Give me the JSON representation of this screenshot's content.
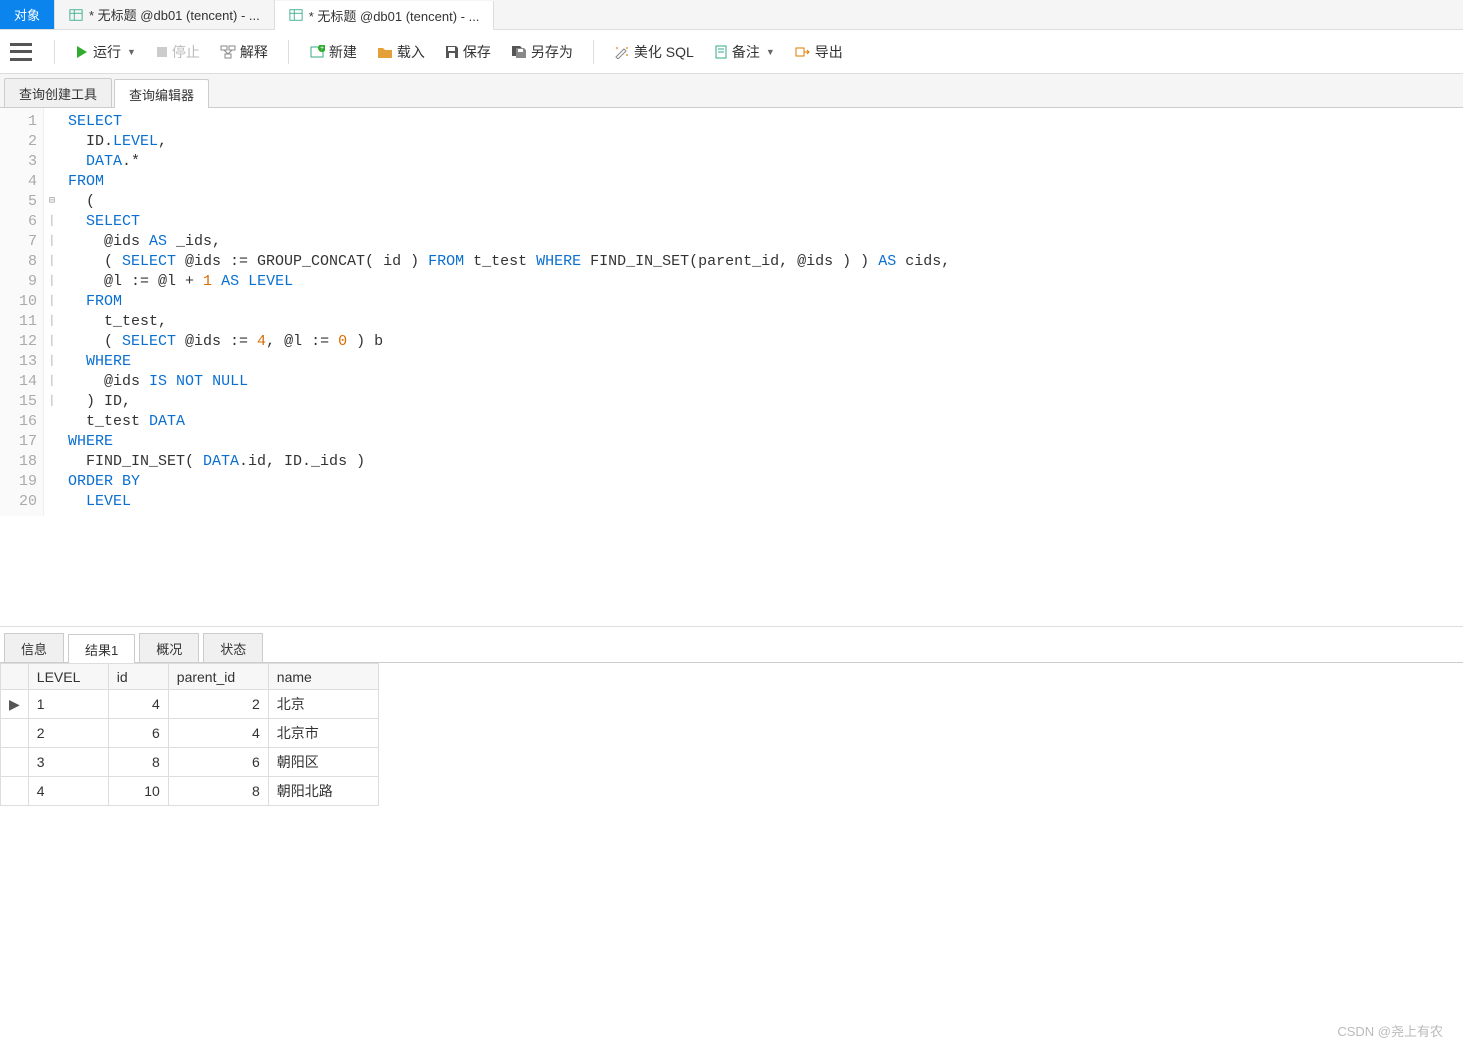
{
  "top_tabs": [
    {
      "label": "对象",
      "kind": "object",
      "active": "blue"
    },
    {
      "label": "* 无标题 @db01 (tencent) - ...",
      "kind": "query",
      "active": ""
    },
    {
      "label": "* 无标题 @db01 (tencent) - ...",
      "kind": "query",
      "active": "white"
    }
  ],
  "toolbar": {
    "run": "运行",
    "stop": "停止",
    "explain": "解释",
    "new": "新建",
    "load": "载入",
    "save": "保存",
    "saveas": "另存为",
    "beautify": "美化 SQL",
    "notes": "备注",
    "export": "导出"
  },
  "subtabs": {
    "builder": "查询创建工具",
    "editor": "查询编辑器"
  },
  "editor": {
    "lines": [
      {
        "n": 1,
        "seg": [
          {
            "c": "kw",
            "t": "SELECT"
          }
        ]
      },
      {
        "n": 2,
        "seg": [
          {
            "c": "",
            "t": "  ID."
          },
          {
            "c": "kw",
            "t": "LEVEL"
          },
          {
            "c": "",
            "t": ","
          }
        ]
      },
      {
        "n": 3,
        "seg": [
          {
            "c": "",
            "t": "  "
          },
          {
            "c": "kw",
            "t": "DATA"
          },
          {
            "c": "",
            "t": ".* "
          }
        ]
      },
      {
        "n": 4,
        "seg": [
          {
            "c": "kw",
            "t": "FROM"
          }
        ]
      },
      {
        "n": 5,
        "seg": [
          {
            "c": "",
            "t": "  ("
          }
        ]
      },
      {
        "n": 6,
        "seg": [
          {
            "c": "",
            "t": "  "
          },
          {
            "c": "kw",
            "t": "SELECT"
          }
        ]
      },
      {
        "n": 7,
        "seg": [
          {
            "c": "",
            "t": "    @ids "
          },
          {
            "c": "kw",
            "t": "AS"
          },
          {
            "c": "",
            "t": " _ids,"
          }
        ]
      },
      {
        "n": 8,
        "seg": [
          {
            "c": "",
            "t": "    ( "
          },
          {
            "c": "kw",
            "t": "SELECT"
          },
          {
            "c": "",
            "t": " @ids := GROUP_CONCAT( id ) "
          },
          {
            "c": "kw",
            "t": "FROM"
          },
          {
            "c": "",
            "t": " t_test "
          },
          {
            "c": "kw",
            "t": "WHERE"
          },
          {
            "c": "",
            "t": " FIND_IN_SET(parent_id, @ids ) ) "
          },
          {
            "c": "kw",
            "t": "AS"
          },
          {
            "c": "",
            "t": " cids,"
          }
        ]
      },
      {
        "n": 9,
        "seg": [
          {
            "c": "",
            "t": "    @l := @l + "
          },
          {
            "c": "num",
            "t": "1"
          },
          {
            "c": "",
            "t": " "
          },
          {
            "c": "kw",
            "t": "AS"
          },
          {
            "c": "",
            "t": " "
          },
          {
            "c": "kw",
            "t": "LEVEL"
          },
          {
            "c": "",
            "t": " "
          }
        ]
      },
      {
        "n": 10,
        "seg": [
          {
            "c": "",
            "t": "  "
          },
          {
            "c": "kw",
            "t": "FROM"
          }
        ]
      },
      {
        "n": 11,
        "seg": [
          {
            "c": "",
            "t": "    t_test,"
          }
        ]
      },
      {
        "n": 12,
        "seg": [
          {
            "c": "",
            "t": "    ( "
          },
          {
            "c": "kw",
            "t": "SELECT"
          },
          {
            "c": "",
            "t": " @ids := "
          },
          {
            "c": "num",
            "t": "4"
          },
          {
            "c": "",
            "t": ", @l := "
          },
          {
            "c": "num",
            "t": "0"
          },
          {
            "c": "",
            "t": " ) b"
          }
        ]
      },
      {
        "n": 13,
        "seg": [
          {
            "c": "",
            "t": "  "
          },
          {
            "c": "kw",
            "t": "WHERE"
          }
        ]
      },
      {
        "n": 14,
        "seg": [
          {
            "c": "",
            "t": "    @ids "
          },
          {
            "c": "kw",
            "t": "IS"
          },
          {
            "c": "",
            "t": " "
          },
          {
            "c": "kw",
            "t": "NOT"
          },
          {
            "c": "",
            "t": " "
          },
          {
            "c": "kw",
            "t": "NULL"
          },
          {
            "c": "",
            "t": " "
          }
        ]
      },
      {
        "n": 15,
        "seg": [
          {
            "c": "",
            "t": "  ) ID,"
          }
        ]
      },
      {
        "n": 16,
        "seg": [
          {
            "c": "",
            "t": "  t_test "
          },
          {
            "c": "kw",
            "t": "DATA"
          },
          {
            "c": "",
            "t": " "
          }
        ]
      },
      {
        "n": 17,
        "seg": [
          {
            "c": "kw",
            "t": "WHERE"
          }
        ]
      },
      {
        "n": 18,
        "seg": [
          {
            "c": "",
            "t": "  FIND_IN_SET( "
          },
          {
            "c": "kw",
            "t": "DATA"
          },
          {
            "c": "",
            "t": ".id, ID._ids ) "
          }
        ]
      },
      {
        "n": 19,
        "seg": [
          {
            "c": "kw",
            "t": "ORDER BY"
          }
        ]
      },
      {
        "n": 20,
        "seg": [
          {
            "c": "",
            "t": "  "
          },
          {
            "c": "kw",
            "t": "LEVEL"
          }
        ]
      }
    ]
  },
  "result_panel": {
    "tabs": {
      "info": "信息",
      "result1": "结果1",
      "profile": "概况",
      "status": "状态"
    },
    "columns": [
      "LEVEL",
      "id",
      "parent_id",
      "name"
    ],
    "rows": [
      {
        "LEVEL": "1",
        "id": "4",
        "parent_id": "2",
        "name": "北京"
      },
      {
        "LEVEL": "2",
        "id": "6",
        "parent_id": "4",
        "name": "北京市"
      },
      {
        "LEVEL": "3",
        "id": "8",
        "parent_id": "6",
        "name": "朝阳区"
      },
      {
        "LEVEL": "4",
        "id": "10",
        "parent_id": "8",
        "name": "朝阳北路"
      }
    ]
  },
  "watermark": "CSDN @尧上有农"
}
